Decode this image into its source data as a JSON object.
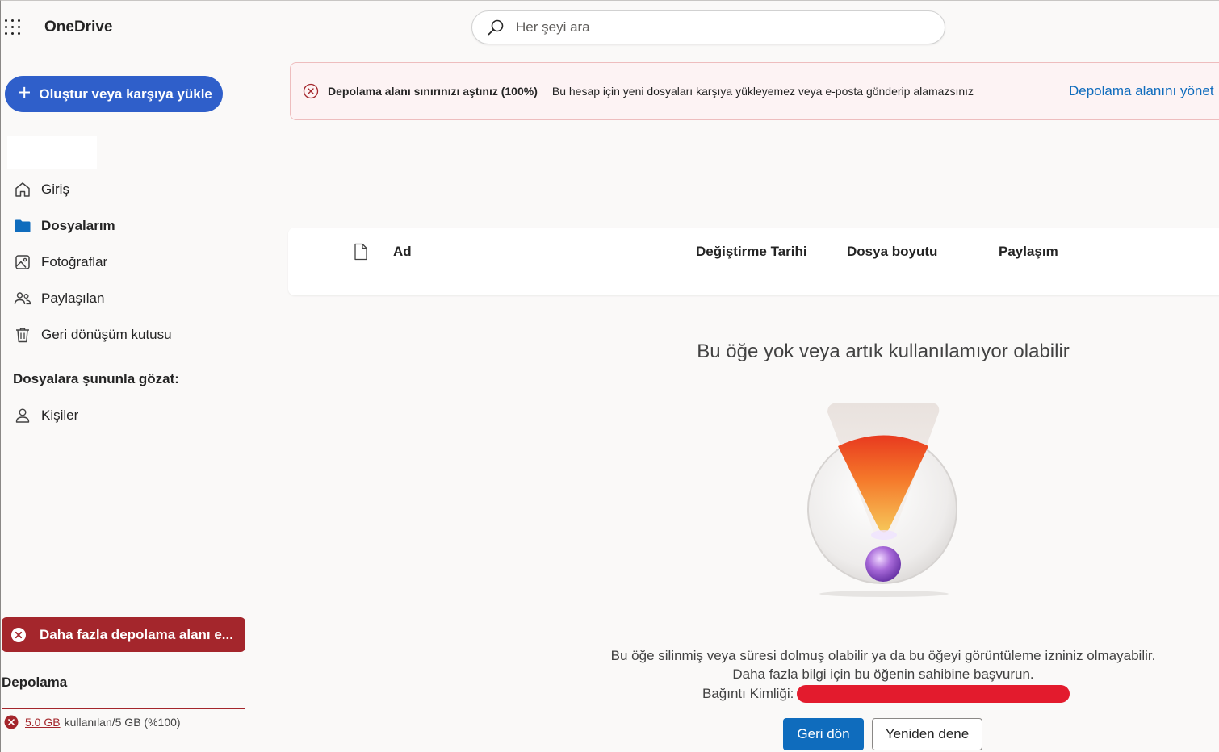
{
  "app": {
    "name": "OneDrive"
  },
  "search": {
    "placeholder": "Her şeyi ara"
  },
  "sidebar": {
    "create_label": "Oluştur veya karşıya yükle",
    "items": [
      {
        "label": "Giriş",
        "icon": "home-icon"
      },
      {
        "label": "Dosyalarım",
        "icon": "folder-icon",
        "active": true
      },
      {
        "label": "Fotoğraflar",
        "icon": "photo-icon"
      },
      {
        "label": "Paylaşılan",
        "icon": "people-icon"
      },
      {
        "label": "Geri dönüşüm kutusu",
        "icon": "trash-icon"
      }
    ],
    "browse_title": "Dosyalara şununla gözat:",
    "browse_items": [
      {
        "label": "Kişiler",
        "icon": "person-icon"
      }
    ],
    "storage_alert": "Daha fazla depolama alanı e...",
    "storage_label": "Depolama",
    "storage_used": "5.0 GB",
    "storage_detail": "kullanılan/5 GB (%100)",
    "storage_fraction": 1.0
  },
  "banner": {
    "title": "Depolama alanı sınırınızı aştınız (100%)",
    "text": "Bu hesap için yeni dosyaları karşıya yükleyemez veya e-posta gönderip alamazsınız",
    "link": "Depolama alanını yönet"
  },
  "file_list": {
    "columns": [
      "Ad",
      "Değiştirme Tarihi",
      "Dosya boyutu",
      "Paylaşım"
    ]
  },
  "empty_state": {
    "title": "Bu öğe yok veya artık kullanılamıyor olabilir",
    "line1": "Bu öğe silinmiş veya süresi dolmuş olabilir ya da bu öğeyi görüntüleme izniniz olmayabilir.",
    "line2": "Daha fazla bilgi için bu öğenin sahibine başvurun.",
    "correlation_label": "Bağıntı Kimliği:",
    "back_button": "Geri dön",
    "retry_button": "Yeniden dene"
  },
  "colors": {
    "accent": "#2f5fca",
    "primary_button": "#0f6cbd",
    "error": "#a4262c",
    "banner_bg": "#fdf3f4",
    "redaction": "#e31b2d"
  }
}
